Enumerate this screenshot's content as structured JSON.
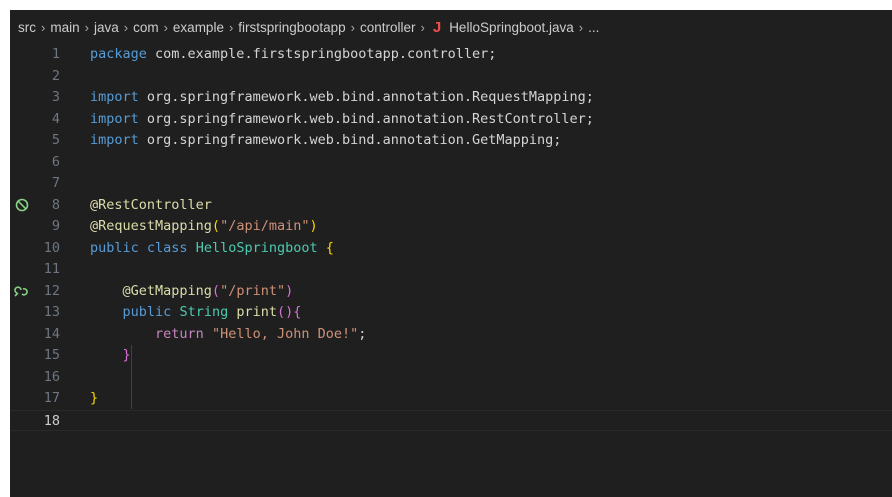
{
  "breadcrumb": {
    "items": [
      "src",
      "main",
      "java",
      "com",
      "example",
      "firstspringbootapp",
      "controller"
    ],
    "file_icon": "J",
    "file_name": "HelloSpringboot.java",
    "ellipsis": "..."
  },
  "gutter": {
    "line8_icon": "run-test-icon",
    "line12_icon": "endpoint-mapping-icon"
  },
  "lines": [
    {
      "n": "1",
      "tokens": [
        [
          "kw",
          "package"
        ],
        [
          "plain_txt",
          " com.example.firstspringbootapp.controller;"
        ]
      ]
    },
    {
      "n": "2",
      "tokens": []
    },
    {
      "n": "3",
      "tokens": [
        [
          "kw",
          "import"
        ],
        [
          "plain_txt",
          " org.springframework.web.bind.annotation.RequestMapping;"
        ]
      ]
    },
    {
      "n": "4",
      "tokens": [
        [
          "kw",
          "import"
        ],
        [
          "plain_txt",
          " org.springframework.web.bind.annotation.RestController;"
        ]
      ]
    },
    {
      "n": "5",
      "tokens": [
        [
          "kw",
          "import"
        ],
        [
          "plain_txt",
          " org.springframework.web.bind.annotation.GetMapping;"
        ]
      ]
    },
    {
      "n": "6",
      "tokens": []
    },
    {
      "n": "7",
      "tokens": []
    },
    {
      "n": "8",
      "tokens": [
        [
          "ann",
          "@RestController"
        ]
      ]
    },
    {
      "n": "9",
      "tokens": [
        [
          "ann",
          "@RequestMapping"
        ],
        [
          "brace1",
          "("
        ],
        [
          "str",
          "\"/api/main\""
        ],
        [
          "brace1",
          ")"
        ]
      ]
    },
    {
      "n": "10",
      "tokens": [
        [
          "kw",
          "public"
        ],
        [
          "plain_txt",
          " "
        ],
        [
          "kw",
          "class"
        ],
        [
          "plain_txt",
          " "
        ],
        [
          "ty",
          "HelloSpringboot"
        ],
        [
          "plain_txt",
          " "
        ],
        [
          "brace1",
          "{"
        ]
      ]
    },
    {
      "n": "11",
      "tokens": []
    },
    {
      "n": "12",
      "tokens": [
        [
          "plain_txt",
          "    "
        ],
        [
          "ann",
          "@GetMapping"
        ],
        [
          "brace2",
          "("
        ],
        [
          "str",
          "\"/print\""
        ],
        [
          "brace2",
          ")"
        ]
      ]
    },
    {
      "n": "13",
      "tokens": [
        [
          "plain_txt",
          "    "
        ],
        [
          "kw",
          "public"
        ],
        [
          "plain_txt",
          " "
        ],
        [
          "ty",
          "String"
        ],
        [
          "plain_txt",
          " "
        ],
        [
          "ann",
          "print"
        ],
        [
          "brace2",
          "()"
        ],
        [
          "brace2",
          "{"
        ]
      ]
    },
    {
      "n": "14",
      "tokens": [
        [
          "plain_txt",
          "        "
        ],
        [
          "ctl",
          "return"
        ],
        [
          "plain_txt",
          " "
        ],
        [
          "str",
          "\"Hello, John Doe!\""
        ],
        [
          "plain_txt",
          ";"
        ]
      ]
    },
    {
      "n": "15",
      "tokens": [
        [
          "plain_txt",
          "    "
        ],
        [
          "brace2",
          "}"
        ]
      ]
    },
    {
      "n": "16",
      "tokens": []
    },
    {
      "n": "17",
      "tokens": [
        [
          "brace1",
          "}"
        ]
      ]
    },
    {
      "n": "18",
      "tokens": []
    }
  ],
  "current_line": "18"
}
